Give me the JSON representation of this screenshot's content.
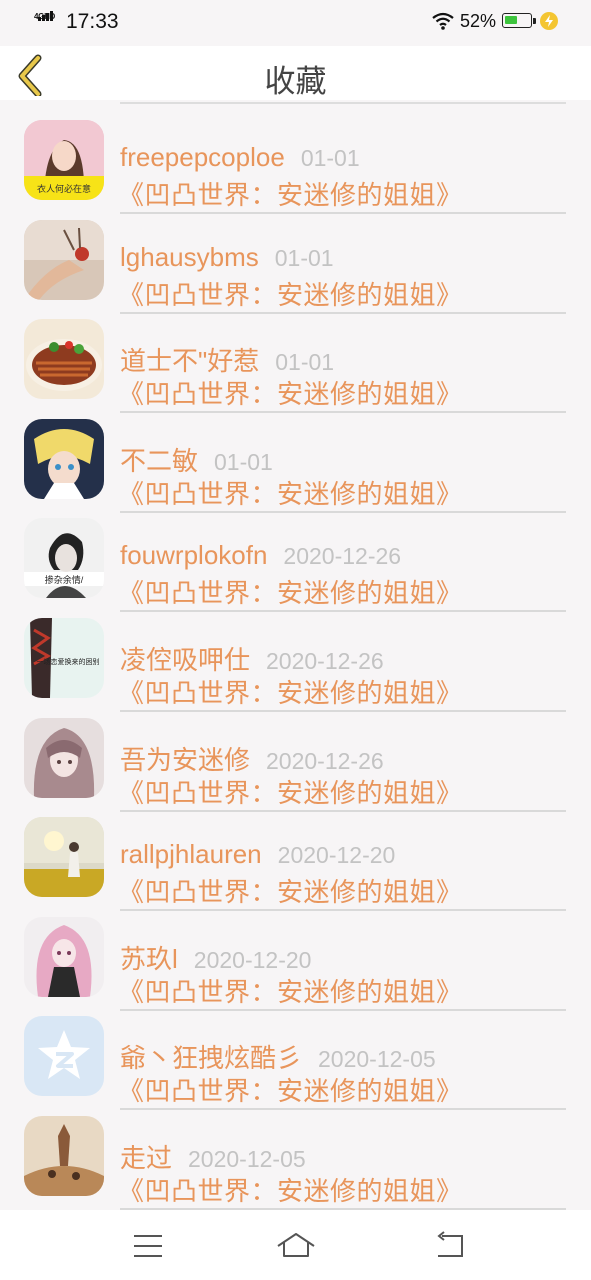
{
  "status_bar": {
    "network": "4GHD",
    "time": "17:33",
    "battery_percent": "52%",
    "battery_level": 0.52
  },
  "header": {
    "title": "收藏",
    "back_icon": "chevron-left-icon"
  },
  "favorites": [
    {
      "user": "freepepcoploe",
      "date": "01-01",
      "book": "《凹凸世界：安迷修的姐姐》"
    },
    {
      "user": "lghausybms",
      "date": "01-01",
      "book": "《凹凸世界：安迷修的姐姐》"
    },
    {
      "user": "道士不\"好惹",
      "date": "01-01",
      "book": "《凹凸世界：安迷修的姐姐》"
    },
    {
      "user": "不二敏",
      "date": "01-01",
      "book": "《凹凸世界：安迷修的姐姐》"
    },
    {
      "user": "fouwrplokofn",
      "date": "2020-12-26",
      "book": "《凹凸世界：安迷修的姐姐》"
    },
    {
      "user": "凌倥吸呷仕",
      "date": "2020-12-26",
      "book": "《凹凸世界：安迷修的姐姐》"
    },
    {
      "user": "吾为安迷修",
      "date": "2020-12-26",
      "book": "《凹凸世界：安迷修的姐姐》"
    },
    {
      "user": "rallpjhlauren",
      "date": "2020-12-20",
      "book": "《凹凸世界：安迷修的姐姐》"
    },
    {
      "user": "苏玖l",
      "date": "2020-12-20",
      "book": "《凹凸世界：安迷修的姐姐》"
    },
    {
      "user": "爺丶狂拽炫酷彡",
      "date": "2020-12-05",
      "book": "《凹凸世界：安迷修的姐姐》"
    },
    {
      "user": "走过",
      "date": "2020-12-05",
      "book": "《凹凸世界：安迷修的姐姐》"
    }
  ],
  "avatar_captions": {
    "row1": "衣人何必在意",
    "row5": "掺杂余情/",
    "row6": "一场恋爱换来的困别"
  },
  "nav_bar": {
    "menu_icon": "menu-icon",
    "home_icon": "home-icon",
    "back_icon": "return-icon"
  },
  "colors": {
    "accent": "#e8955b",
    "date": "#c3c3c3",
    "back_chevron": "#e8c84a",
    "background": "#f7f5f6",
    "divider": "#d9d9d9"
  }
}
